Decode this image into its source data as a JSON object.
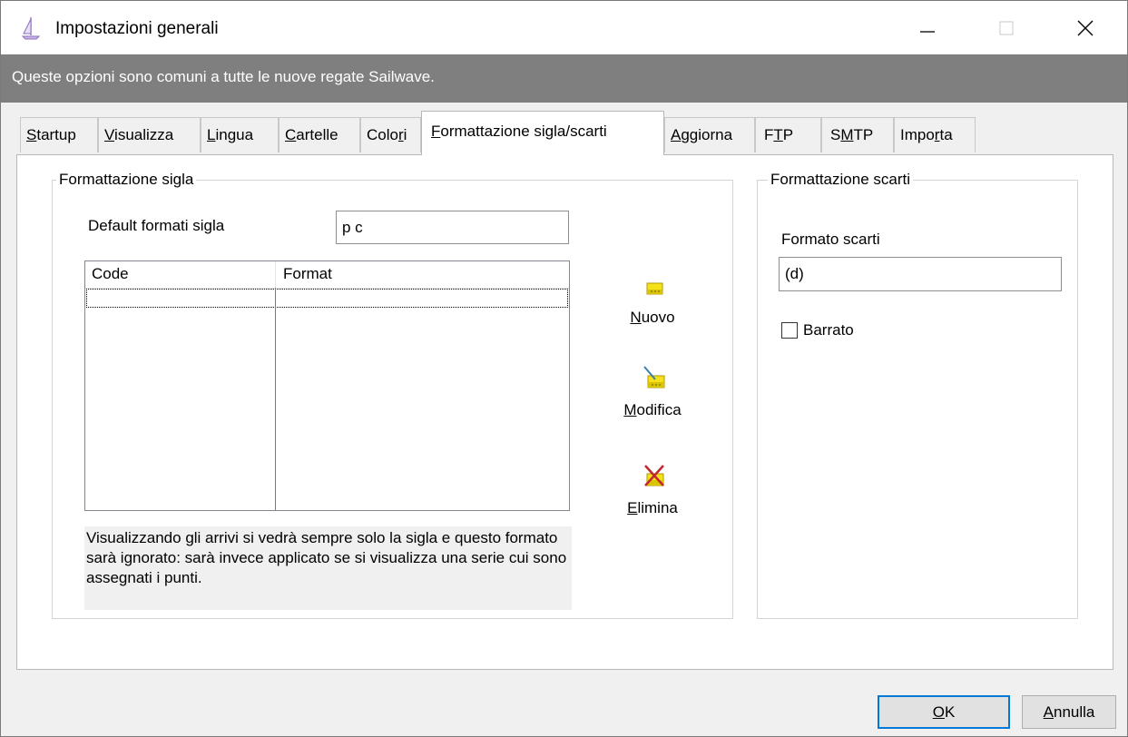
{
  "window": {
    "title": "Impostazioni generali",
    "icon": "sailboat-icon",
    "controls": {
      "minimize": "minimize-icon",
      "maximize": "maximize-icon",
      "close": "close-icon"
    }
  },
  "banner": {
    "text": "Queste opzioni sono comuni a tutte le nuove regate Sailwave."
  },
  "tabs": [
    {
      "pre": "",
      "u": "S",
      "post": "tartup",
      "active": false
    },
    {
      "pre": "",
      "u": "V",
      "post": "isualizza",
      "active": false
    },
    {
      "pre": "",
      "u": "L",
      "post": "ingua",
      "active": false
    },
    {
      "pre": "",
      "u": "C",
      "post": "artelle",
      "active": false
    },
    {
      "pre": "Colo",
      "u": "r",
      "post": "i",
      "active": false
    },
    {
      "pre": "",
      "u": "F",
      "post": "ormattazione sigla/scarti",
      "active": true
    },
    {
      "pre": "",
      "u": "A",
      "post": "ggiorna",
      "active": false
    },
    {
      "pre": "F",
      "u": "T",
      "post": "P",
      "active": false
    },
    {
      "pre": "S",
      "u": "M",
      "post": "TP",
      "active": false
    },
    {
      "pre": "Impo",
      "u": "r",
      "post": "ta",
      "active": false
    }
  ],
  "sigla": {
    "group_title": "Formattazione sigla",
    "default_label": "Default formati sigla",
    "default_value": "p c",
    "columns": [
      "Code",
      "Format"
    ],
    "rows": [],
    "note": "Visualizzando gli arrivi si vedrà sempre solo la sigla e questo formato sarà ignorato: sarà invece applicato se si visualizza una serie cui sono assegnati i punti."
  },
  "buttons": {
    "new": {
      "pre": "",
      "u": "N",
      "post": "uovo",
      "icon": "new-item-icon"
    },
    "edit": {
      "pre": "",
      "u": "M",
      "post": "odifica",
      "icon": "edit-item-icon"
    },
    "delete": {
      "pre": "",
      "u": "E",
      "post": "limina",
      "icon": "delete-item-icon"
    }
  },
  "scarti": {
    "group_title": "Formattazione scarti",
    "format_label": "Formato scarti",
    "format_value": "(d)",
    "strike_label": "Barrato",
    "strike_checked": false
  },
  "footer": {
    "ok": {
      "pre": "",
      "u": "O",
      "post": "K"
    },
    "cancel": {
      "pre": "",
      "u": "A",
      "post": "nnulla"
    }
  },
  "colors": {
    "banner_bg": "#7f7f7f",
    "accent": "#0078d7",
    "icon_yellow": "#f5e11a",
    "delete_red": "#c0282c"
  }
}
